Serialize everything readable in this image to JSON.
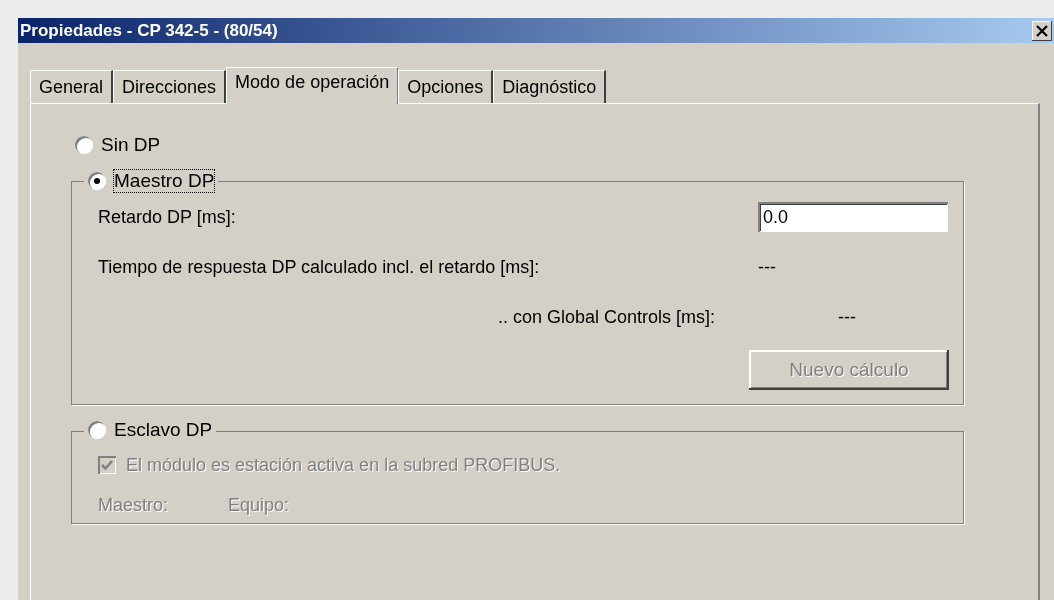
{
  "window": {
    "title": "Propiedades - CP 342-5 - (80/54)"
  },
  "tabs": [
    {
      "label": "General",
      "selected": false
    },
    {
      "label": "Direcciones",
      "selected": false
    },
    {
      "label": "Modo de operación",
      "selected": true
    },
    {
      "label": "Opciones",
      "selected": false
    },
    {
      "label": "Diagnóstico",
      "selected": false
    }
  ],
  "modes": [
    {
      "kind": "plain",
      "label": "Sin DP",
      "selected": false
    },
    {
      "kind": "master",
      "label": "Maestro DP",
      "selected": true,
      "focused": true,
      "delay_label": "Retardo DP [ms]:",
      "delay_value": "0.0",
      "response_label": "Tiempo de respuesta DP calculado incl. el retardo [ms]:",
      "response_value": "---",
      "global_label": ".. con Global Controls [ms]:",
      "global_value": "---",
      "button": {
        "label": "Nuevo cálculo",
        "disabled": true
      }
    },
    {
      "kind": "slave",
      "label": "Esclavo DP",
      "selected": false,
      "disabled": true,
      "checkbox": {
        "label": "El módulo es estación activa en la subred PROFIBUS.",
        "checked": true
      },
      "master_label": "Maestro:",
      "station_label": "Equipo:"
    }
  ]
}
